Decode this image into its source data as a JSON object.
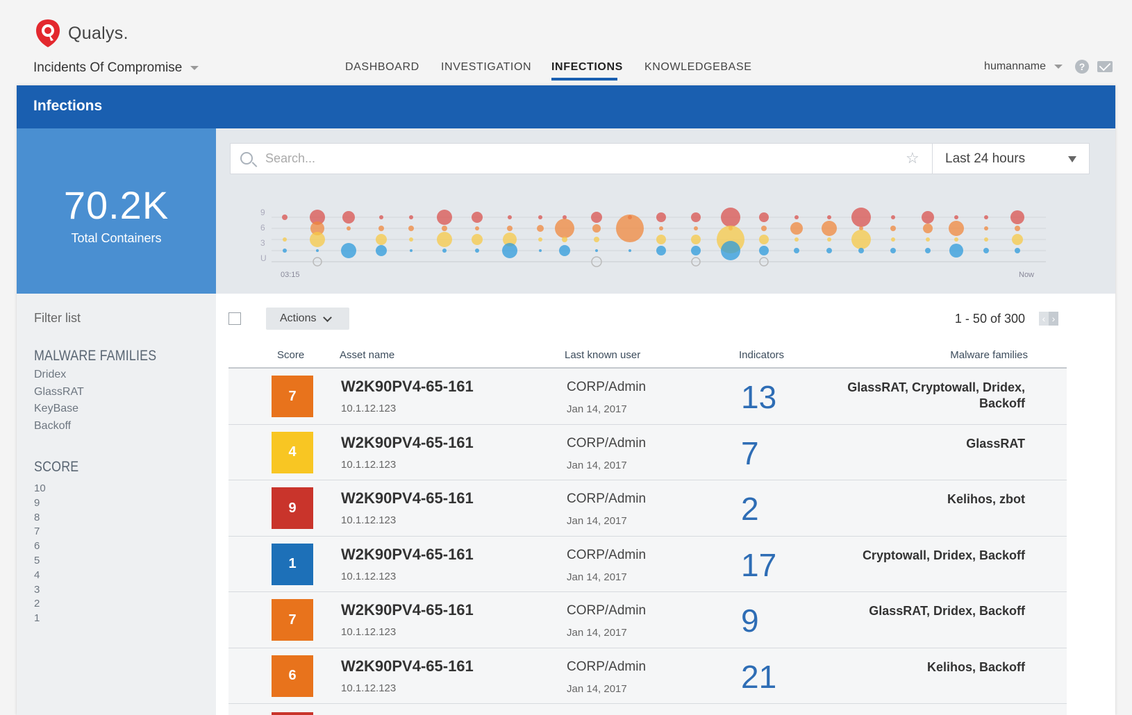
{
  "app": {
    "brand": "Qualys.",
    "module": "Incidents Of Compromise",
    "user": "humanname",
    "help_glyph": "?"
  },
  "nav": {
    "items": [
      {
        "label": "DASHBOARD",
        "active": false
      },
      {
        "label": "INVESTIGATION",
        "active": false
      },
      {
        "label": "INFECTIONS",
        "active": true
      },
      {
        "label": "KNOWLEDGEBASE",
        "active": false
      }
    ]
  },
  "page": {
    "title": "Infections"
  },
  "stats": {
    "value": "70.2K",
    "label": "Total Containers"
  },
  "search": {
    "placeholder": "Search...",
    "time_range": "Last 24 hours"
  },
  "timeline": {
    "y_ticks": [
      "9",
      "6",
      "3",
      "U"
    ],
    "x_start": "03:15",
    "x_end": "Now",
    "colors": {
      "red": "#d9534f",
      "orange": "#f0883e",
      "yellow": "#f7c948",
      "blue": "#2d9bdc",
      "grey": "#bbbbbb"
    }
  },
  "filters": {
    "title": "Filter list",
    "malware_title": "MALWARE FAMILIES",
    "malware": [
      "Dridex",
      "GlassRAT",
      "KeyBase",
      "Backoff"
    ],
    "score_title": "SCORE",
    "scores": [
      "10",
      "9",
      "8",
      "7",
      "6",
      "5",
      "4",
      "3",
      "2",
      "1"
    ]
  },
  "table": {
    "actions_label": "Actions",
    "pager": "1 - 50  of 300",
    "columns": {
      "score": "Score",
      "asset": "Asset name",
      "user": "Last known user",
      "indicators": "Indicators",
      "families": "Malware families"
    },
    "score_colors": {
      "7": "#e8731c",
      "4": "#f8c623",
      "9": "#c9342b",
      "1": "#1d70b8",
      "6": "#e8731c"
    },
    "rows": [
      {
        "score": "7",
        "asset": "W2K90PV4-65-161",
        "ip": "10.1.12.123",
        "user": "CORP/Admin",
        "date": "Jan 14, 2017",
        "indicators": "13",
        "families": "GlassRAT, Cryptowall, Dridex, Backoff"
      },
      {
        "score": "4",
        "asset": "W2K90PV4-65-161",
        "ip": "10.1.12.123",
        "user": "CORP/Admin",
        "date": "Jan 14, 2017",
        "indicators": "7",
        "families": "GlassRAT"
      },
      {
        "score": "9",
        "asset": "W2K90PV4-65-161",
        "ip": "10.1.12.123",
        "user": "CORP/Admin",
        "date": "Jan 14, 2017",
        "indicators": "2",
        "families": "Kelihos, zbot"
      },
      {
        "score": "1",
        "asset": "W2K90PV4-65-161",
        "ip": "10.1.12.123",
        "user": "CORP/Admin",
        "date": "Jan 14, 2017",
        "indicators": "17",
        "families": "Cryptowall, Dridex, Backoff"
      },
      {
        "score": "7",
        "asset": "W2K90PV4-65-161",
        "ip": "10.1.12.123",
        "user": "CORP/Admin",
        "date": "Jan 14, 2017",
        "indicators": "9",
        "families": "GlassRAT, Dridex, Backoff"
      },
      {
        "score": "6",
        "asset": "W2K90PV4-65-161",
        "ip": "10.1.12.123",
        "user": "CORP/Admin",
        "date": "Jan 14, 2017",
        "indicators": "21",
        "families": "Kelihos, Backoff"
      }
    ]
  }
}
